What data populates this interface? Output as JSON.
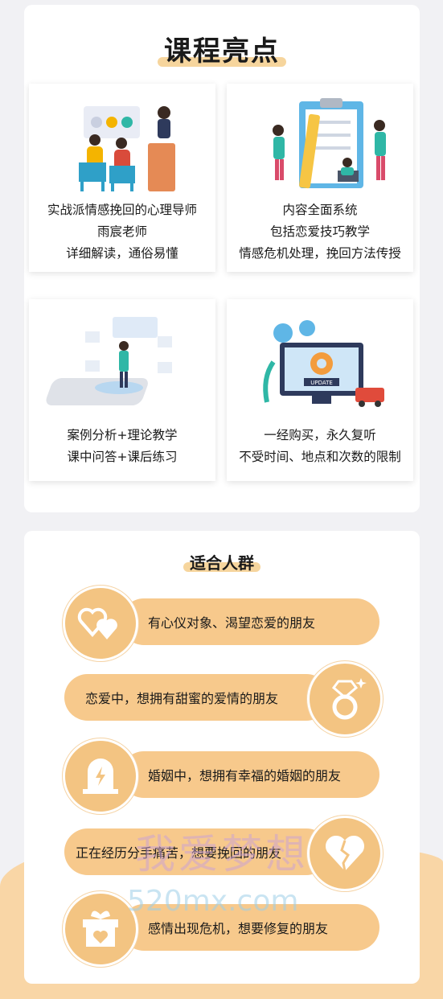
{
  "highlights": {
    "title": "课程亮点",
    "items": [
      {
        "lines": [
          "实战派情感挽回的心理导师",
          "雨宸老师",
          "详细解读，通俗易懂"
        ]
      },
      {
        "lines": [
          "内容全面系统",
          "包括恋爱技巧教学",
          "情感危机处理，挽回方法传授"
        ]
      },
      {
        "lines": [
          "案例分析+理论教学",
          "课中问答+课后练习"
        ]
      },
      {
        "lines": [
          "一经购买，永久复听",
          "不受时间、地点和次数的限制"
        ]
      }
    ]
  },
  "update_label": "UPDATE",
  "audience": {
    "title": "适合人群",
    "items": [
      {
        "text": "有心仪对象、渴望恋爱的朋友",
        "icon": "hearts-icon"
      },
      {
        "text": "恋爱中，想拥有甜蜜的爱情的朋友",
        "icon": "diamond-ring-icon"
      },
      {
        "text": "婚姻中，想拥有幸福的婚姻的朋友",
        "icon": "lightning-icon"
      },
      {
        "text": "正在经历分手痛苦，想要挽回的朋友",
        "icon": "broken-heart-icon"
      },
      {
        "text": "感情出现危机，想要修复的朋友",
        "icon": "gift-box-icon"
      }
    ]
  },
  "watermark": {
    "cn": "我爱梦想",
    "en": "520mx.com"
  },
  "colors": {
    "accent": "#f7c98c",
    "circle": "#f3c482",
    "highlight": "#f6d59d"
  }
}
